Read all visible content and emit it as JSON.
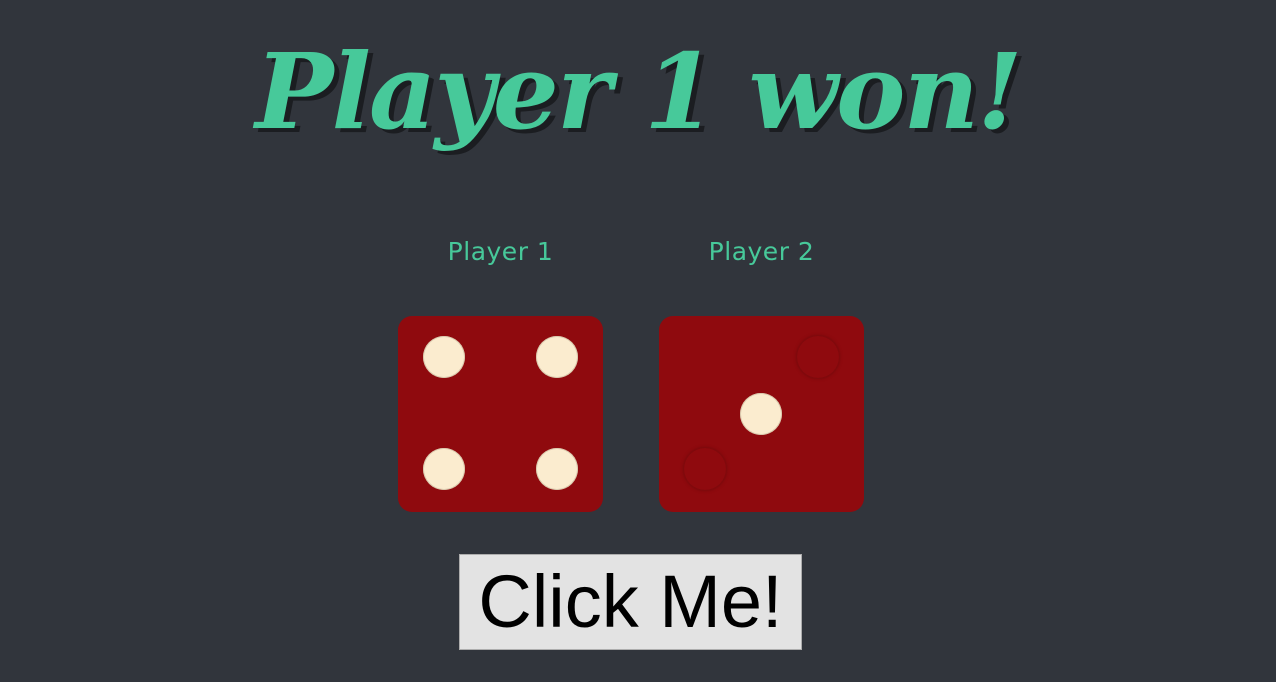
{
  "game": {
    "title": "Player 1 won!",
    "players": [
      {
        "label": "Player 1",
        "die_value": 4
      },
      {
        "label": "Player 2",
        "die_value": 1
      }
    ],
    "button_label": "Click Me!"
  },
  "colors": {
    "background": "#31353c",
    "accent": "#47c99a",
    "die_face": "#8f0a0e",
    "pip": "#fbeccf",
    "button_bg": "#e3e3e3"
  }
}
